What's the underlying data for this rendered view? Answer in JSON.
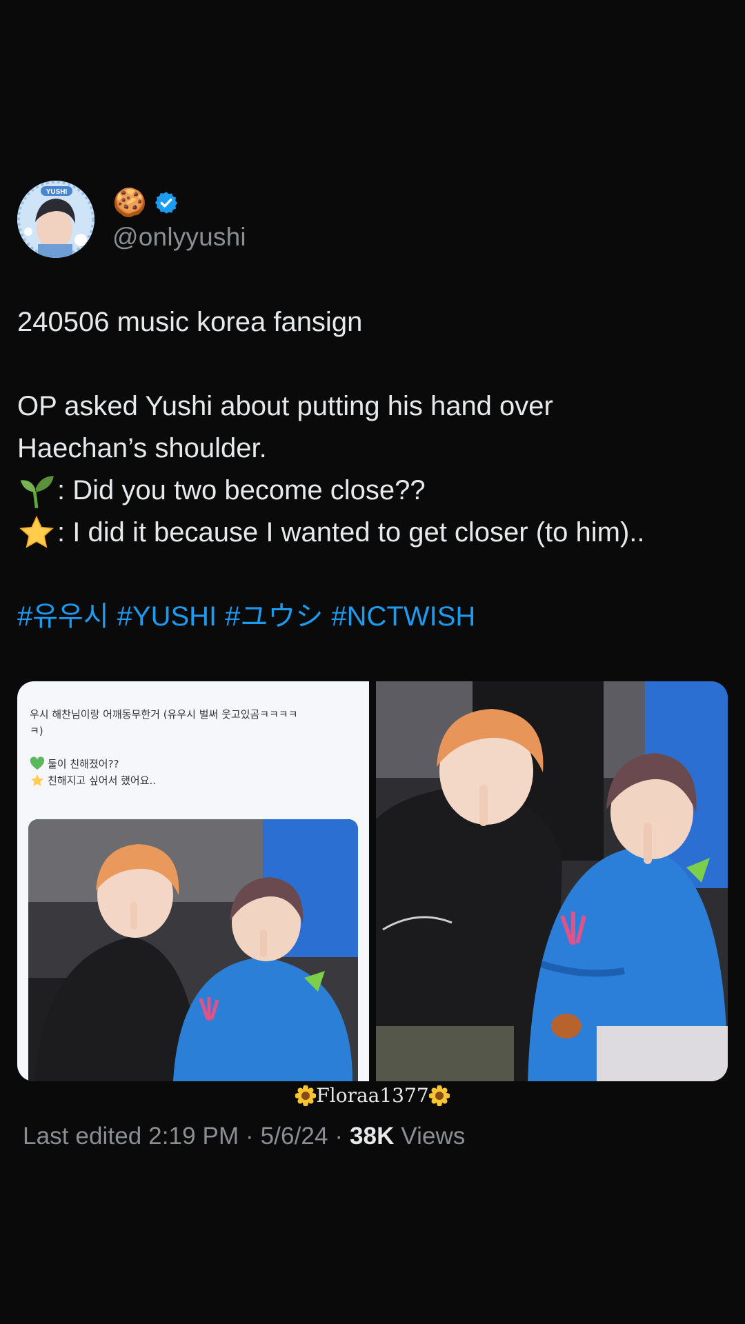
{
  "author": {
    "display_name_emoji": "🍪",
    "handle": "@onlyyushi",
    "avatar_badge": "YUSHI",
    "verified_icon": "verified-badge-icon"
  },
  "tweet": {
    "line1": "240506 music korea fansign",
    "line2": "OP asked Yushi about putting his hand over",
    "line3": "Haechan’s shoulder.",
    "line4": ": Did you two become close??",
    "line5": ": I did it because I wanted to get closer (to him)..",
    "line4_icon": "seedling-icon",
    "line5_icon": "star-icon",
    "hashtags": [
      "#유우시",
      "#YUSHI",
      "#ユウシ",
      "#NCTWISH"
    ]
  },
  "media": {
    "left_caption_1": "우시 해찬님이랑 어깨동무한거 (유우시 벌써 웃고있곰ㅋㅋㅋㅋ",
    "left_caption_2": "ㅋ)",
    "left_q": "둘이 친해졌어??",
    "left_a": "친해지고 싶어서 했어요..",
    "left_q_icon": "green-heart-icon",
    "left_a_icon": "star-icon"
  },
  "watermark": "Floraa1377",
  "meta": {
    "edited": "Last edited 2:19 PM · 5/6/24",
    "separator": " · ",
    "views_count": "38K",
    "views_label": " Views"
  },
  "colors": {
    "background": "#0a0a0a",
    "text": "#e7e9ea",
    "secondary": "#8b8f94",
    "link": "#1d9bf0",
    "verified": "#1d9bf0"
  }
}
